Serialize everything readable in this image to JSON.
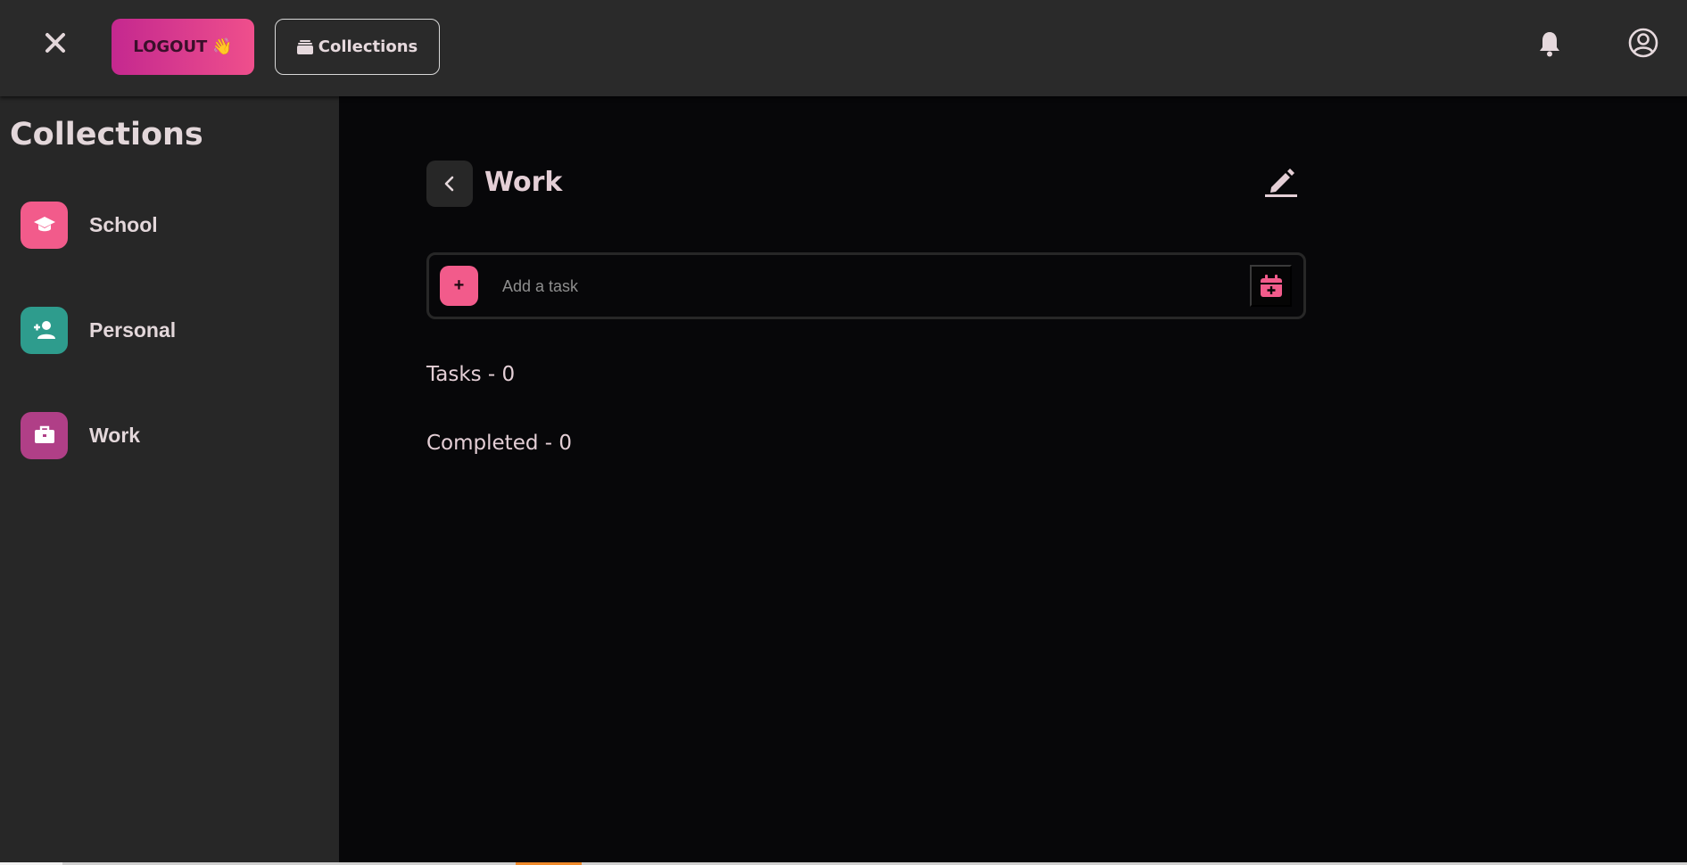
{
  "colors": {
    "topbar_bg": "#2a2a2a",
    "sidebar_bg": "#272727",
    "main_bg": "#070709",
    "accent_pink": "#f25b8b",
    "school_icon_bg": "#f25b8b",
    "personal_icon_bg": "#2e9c8d",
    "work_icon_bg": "#b03f87",
    "text": "#e4cfd6"
  },
  "topbar": {
    "close_icon": "close-icon",
    "logout_label": "LOGOUT",
    "logout_emoji": "👋",
    "collections_label": "Collections",
    "collections_icon": "stack-icon",
    "bell_icon": "bell-icon",
    "account_icon": "account-circle-icon"
  },
  "sidebar": {
    "title": "Collections",
    "items": [
      {
        "label": "School",
        "icon": "graduation-cap-icon"
      },
      {
        "label": "Personal",
        "icon": "person-add-icon"
      },
      {
        "label": "Work",
        "icon": "briefcase-icon"
      }
    ]
  },
  "main": {
    "title": "Work",
    "back_icon": "chevron-left-icon",
    "edit_icon": "pencil-icon",
    "add_task": {
      "button_label": "+",
      "placeholder": "Add a task",
      "value": "",
      "date_icon": "calendar-add-icon"
    },
    "tasks_label": "Tasks - 0",
    "completed_label": "Completed - 0"
  }
}
